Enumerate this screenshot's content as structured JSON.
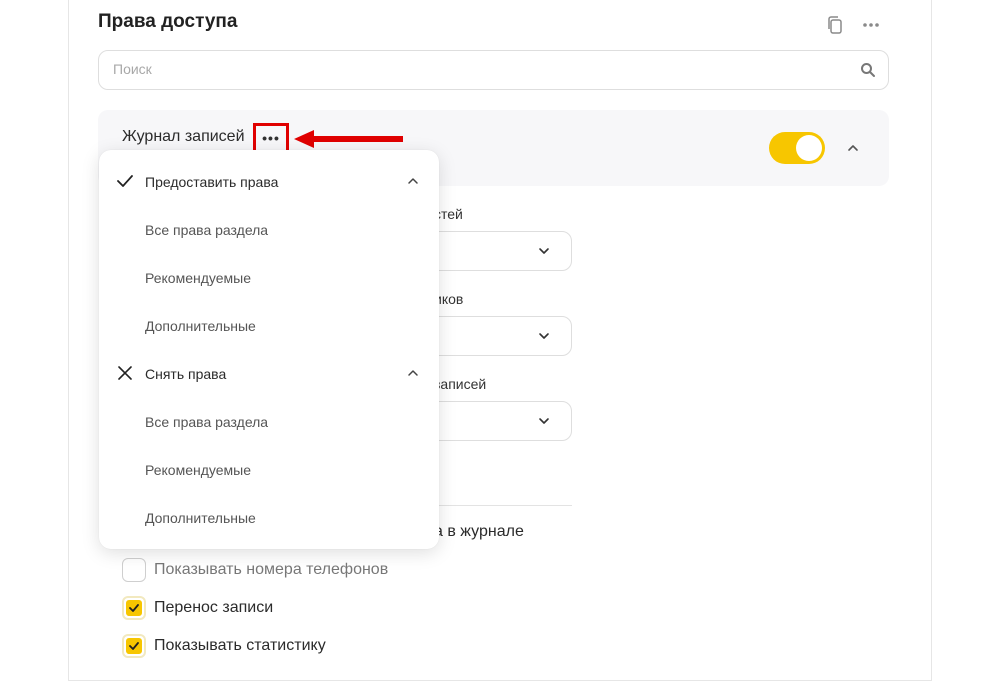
{
  "header": {
    "title": "Права доступа",
    "copy_icon": "copy-icon",
    "more_icon": "more-horizontal-icon"
  },
  "search": {
    "placeholder": "Поиск",
    "value": ""
  },
  "section": {
    "title": "Журнал записей",
    "more_label": "•••",
    "toggle_on": true,
    "accent_color": "#f7c600"
  },
  "fields": {
    "label1_partial": "стей",
    "label2_partial": "иков",
    "label3_partial": "записей"
  },
  "journal_label_partial": "а в журнале",
  "checkboxes": [
    {
      "label": "Показывать номера телефонов",
      "checked": false
    },
    {
      "label": "Перенос записи",
      "checked": true
    },
    {
      "label": "Показывать статистику",
      "checked": true
    }
  ],
  "menu": {
    "grant": {
      "label": "Предоставить права",
      "icon": "check-icon",
      "items": [
        "Все права раздела",
        "Рекомендуемые",
        "Дополнительные"
      ]
    },
    "revoke": {
      "label": "Снять права",
      "icon": "close-icon",
      "items": [
        "Все права раздела",
        "Рекомендуемые",
        "Дополнительные"
      ]
    }
  },
  "annotation": {
    "color": "#e00000"
  }
}
